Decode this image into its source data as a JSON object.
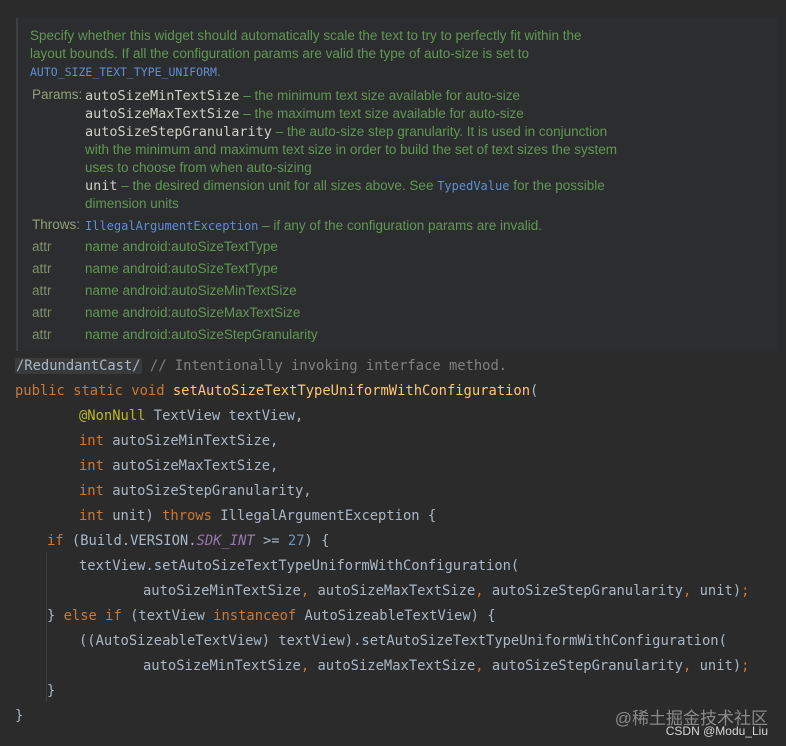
{
  "doc": {
    "para1_line1": "Specify whether this widget should automatically scale the text to try to perfectly fit within the",
    "para1_line2": "layout bounds. If all the configuration params are valid the type of auto-size is set to",
    "para1_const": "AUTO_SIZE_TEXT_TYPE_UNIFORM",
    "para1_end": ".",
    "params_label": "Params:",
    "params": [
      {
        "name": "autoSizeMinTextSize",
        "desc": " – the minimum text size available for auto-size"
      },
      {
        "name": "autoSizeMaxTextSize",
        "desc": " – the maximum text size available for auto-size"
      },
      {
        "name": "autoSizeStepGranularity",
        "desc": " – the auto-size step granularity. It is used in conjunction"
      }
    ],
    "step_cont1": "with the minimum and maximum text size in order to build the set of text sizes the system",
    "step_cont2": "uses to choose from when auto-sizing",
    "unit_name": "unit",
    "unit_desc": " – the desired dimension unit for all sizes above. See ",
    "unit_link": "TypedValue",
    "unit_desc2": " for the possible",
    "unit_cont": "dimension units",
    "throws_label": "Throws:",
    "throws_link": "IllegalArgumentException",
    "throws_desc": " – if any of the configuration params are invalid.",
    "attrs": [
      {
        "k": "attr",
        "v": "name android:autoSizeTextType"
      },
      {
        "k": "attr",
        "v": "name android:autoSizeTextType"
      },
      {
        "k": "attr",
        "v": "name android:autoSizeMinTextSize"
      },
      {
        "k": "attr",
        "v": "name android:autoSizeMaxTextSize"
      },
      {
        "k": "attr",
        "v": "name android:autoSizeStepGranularity"
      }
    ]
  },
  "code": {
    "l1_suppress": "/RedundantCast/",
    "l1_comment": " // Intentionally invoking interface method.",
    "l2_kw": "public static void ",
    "l2_fn": "setAutoSizeTextTypeUniformWithConfiguration",
    "l2_rest": "(",
    "l3_ann": "@NonNull",
    "l3_rest": " TextView textView,",
    "l4_kw": "int",
    "l4_rest": " autoSizeMinTextSize,",
    "l5_kw": "int",
    "l5_rest": " autoSizeMaxTextSize,",
    "l6_kw": "int",
    "l6_rest": " autoSizeStepGranularity,",
    "l7_kw": "int",
    "l7_mid": " unit) ",
    "l7_kw2": "throws",
    "l7_rest": " IllegalArgumentException {",
    "l8_kw": "if",
    "l8_a": " (Build.VERSION.",
    "l8_st": "SDK_INT",
    "l8_b": " >= ",
    "l8_num": "27",
    "l8_c": ") {",
    "l9": "textView.setAutoSizeTextTypeUniformWithConfiguration(",
    "l10_a": "autoSizeMinTextSize",
    "l10_b": "autoSizeMaxTextSize",
    "l10_c": "autoSizeStepGranularity",
    "l10_d": "unit",
    "l11_a": "} ",
    "l11_kw": "else if",
    "l11_b": " (textView ",
    "l11_kw2": "instanceof",
    "l11_c": " AutoSizeableTextView) {",
    "l12": "((AutoSizeableTextView) textView).setAutoSizeTextTypeUniformWithConfiguration(",
    "l13_a": "autoSizeMinTextSize",
    "l13_b": "autoSizeMaxTextSize",
    "l13_c": "autoSizeStepGranularity",
    "l13_d": "unit",
    "l14": "}",
    "l15": "}"
  },
  "watermark": {
    "line1": "@稀土掘金技术社区",
    "line2": "CSDN @Modu_Liu"
  },
  "colors": {
    "background": "#2b2b2b",
    "doc_text": "#629755",
    "keyword": "#cc7832",
    "function": "#ffc66d",
    "annotation": "#bbb529",
    "number": "#6897bb",
    "comment": "#808080",
    "static_field": "#9876aa",
    "link": "#5e8fd6"
  }
}
